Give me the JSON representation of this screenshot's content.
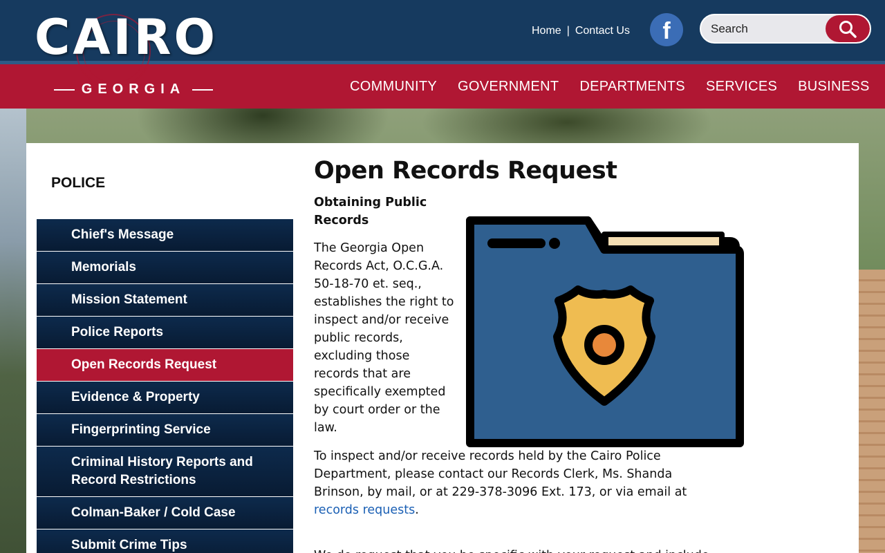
{
  "header": {
    "logo_word": "CAIRO",
    "logo_sub": "GEORGIA",
    "top_links": [
      "Home",
      "Contact Us"
    ],
    "separator": "|",
    "facebook_glyph": "f",
    "search_placeholder": "Search",
    "nav": [
      "COMMUNITY",
      "GOVERNMENT",
      "DEPARTMENTS",
      "SERVICES",
      "BUSINESS"
    ],
    "colors": {
      "top_bar": "#163a5f",
      "nav_bar": "#b01733",
      "facebook": "#3b6db6"
    }
  },
  "sidebar": {
    "title": "POLICE",
    "items": [
      {
        "label": "Chief's Message"
      },
      {
        "label": "Memorials"
      },
      {
        "label": "Mission Statement"
      },
      {
        "label": "Police Reports"
      },
      {
        "label": "Open Records Request",
        "active": true
      },
      {
        "label": "Evidence & Property"
      },
      {
        "label": "Fingerprinting Service"
      },
      {
        "label": "Criminal History Reports and Record Restrictions"
      },
      {
        "label": "Colman-Baker / Cold Case"
      },
      {
        "label": "Submit Crime Tips"
      }
    ]
  },
  "main": {
    "title": "Open Records Request",
    "section_heading": "Obtaining Public Records",
    "paragraph1": "The Georgia Open Records Act, O.C.G.A. 50-18-70 et. seq., establishes the right to inspect and/or receive public records, excluding those records that are specifically exempted by court order or the law.",
    "paragraph2_before_link": "To inspect and/or receive records held by the Cairo Police Department, please contact our Records Clerk, Ms. Shanda Brinson, by mail, or at 229-378-3096 Ext. 173, or via email at ",
    "paragraph2_link": "records requests",
    "paragraph2_after_link": ".",
    "paragraph3": "We do request that you be specific with your request and include",
    "illustration": "police-badge-folder-icon"
  }
}
